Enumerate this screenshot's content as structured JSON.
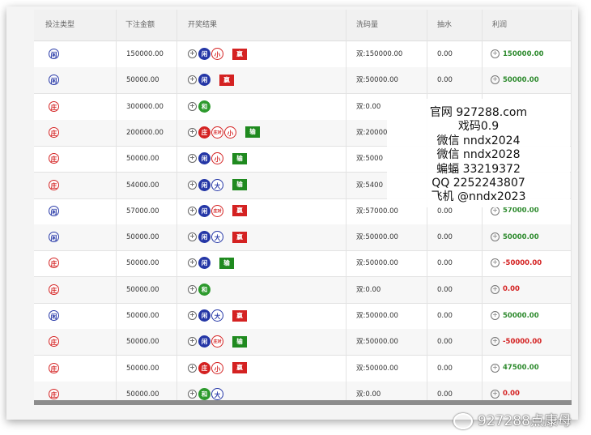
{
  "table": {
    "headers": {
      "bet_type": "投注类型",
      "amount": "下注金额",
      "result": "开奖结果",
      "wash": "洗码量",
      "commission": "抽水",
      "profit": "利润"
    },
    "rows": [
      {
        "bet": "闲",
        "amount": "150000.00",
        "result": [
          "闲",
          "小"
        ],
        "outcome": "赢",
        "wash": "双:150000.00",
        "commission": "0.00",
        "profit": "150000.00",
        "profit_sign": "pos"
      },
      {
        "bet": "闲",
        "amount": "50000.00",
        "result": [
          "闲"
        ],
        "outcome": "赢",
        "wash": "双:50000.00",
        "commission": "0.00",
        "profit": "50000.00",
        "profit_sign": "pos"
      },
      {
        "bet": "庄",
        "amount": "300000.00",
        "result": [
          "和"
        ],
        "outcome": "",
        "wash": "双:0.00",
        "commission": "",
        "profit": "",
        "profit_sign": "pos"
      },
      {
        "bet": "庄",
        "amount": "200000.00",
        "result": [
          "庄",
          "庄对",
          "小"
        ],
        "outcome": "输",
        "wash": "双:20000",
        "commission": "",
        "profit": "",
        "profit_sign": "pos"
      },
      {
        "bet": "庄",
        "amount": "50000.00",
        "result": [
          "闲",
          "小"
        ],
        "outcome": "输",
        "wash": "双:5000",
        "commission": "",
        "profit": "",
        "profit_sign": "pos"
      },
      {
        "bet": "庄",
        "amount": "54000.00",
        "result": [
          "闲",
          "大"
        ],
        "outcome": "输",
        "wash": "双:5400",
        "commission": "",
        "profit": "",
        "profit_sign": "pos"
      },
      {
        "bet": "闲",
        "amount": "57000.00",
        "result": [
          "闲",
          "庄对"
        ],
        "outcome": "赢",
        "wash": "双:57000.00",
        "commission": "0.00",
        "profit": "57000.00",
        "profit_sign": "pos"
      },
      {
        "bet": "闲",
        "amount": "50000.00",
        "result": [
          "闲",
          "大"
        ],
        "outcome": "赢",
        "wash": "双:50000.00",
        "commission": "0.00",
        "profit": "50000.00",
        "profit_sign": "pos"
      },
      {
        "bet": "庄",
        "amount": "50000.00",
        "result": [
          "闲"
        ],
        "outcome": "输",
        "wash": "双:50000.00",
        "commission": "0.00",
        "profit": "-50000.00",
        "profit_sign": "neg"
      },
      {
        "bet": "庄",
        "amount": "50000.00",
        "result": [
          "和"
        ],
        "outcome": "",
        "wash": "双:0.00",
        "commission": "0.00",
        "profit": "0.00",
        "profit_sign": "neg"
      },
      {
        "bet": "闲",
        "amount": "50000.00",
        "result": [
          "闲",
          "大"
        ],
        "outcome": "赢",
        "wash": "双:50000.00",
        "commission": "0.00",
        "profit": "50000.00",
        "profit_sign": "pos"
      },
      {
        "bet": "庄",
        "amount": "50000.00",
        "result": [
          "闲",
          "庄对"
        ],
        "outcome": "输",
        "wash": "双:50000.00",
        "commission": "0.00",
        "profit": "-50000.00",
        "profit_sign": "neg"
      },
      {
        "bet": "庄",
        "amount": "50000.00",
        "result": [
          "庄",
          "小"
        ],
        "outcome": "赢",
        "wash": "双:50000.00",
        "commission": "0.00",
        "profit": "47500.00",
        "profit_sign": "pos"
      },
      {
        "bet": "庄",
        "amount": "50000.00",
        "result": [
          "和",
          "大"
        ],
        "outcome": "",
        "wash": "双:0.00",
        "commission": "0.00",
        "profit": "0.00",
        "profit_sign": "neg"
      }
    ]
  },
  "overlay": {
    "lines": [
      "官网 927288.com",
      "戏码0.9",
      "微信 nndx2024",
      "微信 nndx2028",
      "蝙蝠 33219372",
      "QQ  2252243807",
      "飞机 @nndx2023"
    ]
  },
  "watermark": "927288点康母",
  "colors": {
    "red": "#d42222",
    "blue": "#2436a6",
    "green": "#2d9a2d"
  }
}
